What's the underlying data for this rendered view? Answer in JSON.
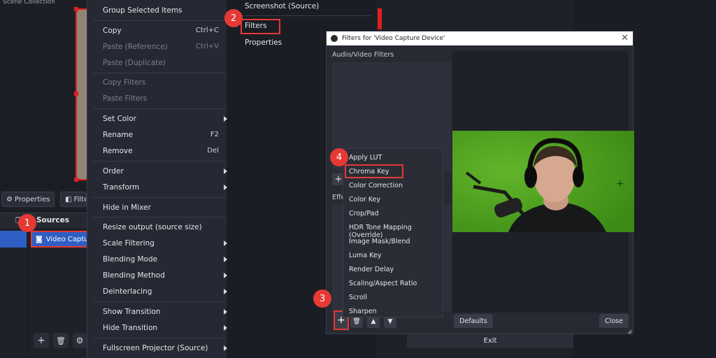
{
  "background": {
    "top_text": "Scene Collection",
    "properties_button": "Properties",
    "filters_button": "Filte",
    "sources_header": "Sources",
    "source_item": "Video Captu"
  },
  "context_menu": {
    "items": [
      {
        "label": "Group Selected Items"
      },
      {
        "label": "Copy",
        "shortcut": "Ctrl+C"
      },
      {
        "label": "Paste (Reference)",
        "shortcut": "Ctrl+V",
        "disabled": true
      },
      {
        "label": "Paste (Duplicate)",
        "disabled": true
      },
      {
        "label": "Copy Filters",
        "disabled": true
      },
      {
        "label": "Paste Filters",
        "disabled": true
      },
      {
        "label": "Set Color",
        "submenu": true
      },
      {
        "label": "Rename",
        "shortcut": "F2"
      },
      {
        "label": "Remove",
        "shortcut": "Del"
      },
      {
        "label": "Order",
        "submenu": true
      },
      {
        "label": "Transform",
        "submenu": true
      },
      {
        "label": "Hide in Mixer"
      },
      {
        "label": "Resize output (source size)"
      },
      {
        "label": "Scale Filtering",
        "submenu": true
      },
      {
        "label": "Blending Mode",
        "submenu": true
      },
      {
        "label": "Blending Method",
        "submenu": true
      },
      {
        "label": "Deinterlacing",
        "submenu": true
      },
      {
        "label": "Show Transition",
        "submenu": true
      },
      {
        "label": "Hide Transition",
        "submenu": true
      },
      {
        "label": "Fullscreen Projector (Source)",
        "submenu": true
      }
    ]
  },
  "submenu": {
    "screenshot": "Screenshot (Source)",
    "filters": "Filters",
    "properties": "Properties"
  },
  "dialog": {
    "title": "Filters for 'Video Capture Device'",
    "audio_video_label": "Audio/Video Filters",
    "effect_label": "Effe",
    "defaults_button": "Defaults",
    "close_button": "Close"
  },
  "dropdown": {
    "items": [
      "Apply LUT",
      "Chroma Key",
      "Color Correction",
      "Color Key",
      "Crop/Pad",
      "HDR Tone Mapping (Override)",
      "Image Mask/Blend",
      "Luma Key",
      "Render Delay",
      "Scaling/Aspect Ratio",
      "Scroll",
      "Sharpen"
    ]
  },
  "exit_button": "Exit",
  "steps": [
    "1",
    "2",
    "3",
    "4"
  ],
  "colors": {
    "highlight": "#e53935",
    "selection": "#2f5ec4",
    "green_screen": "#4a9a1c"
  }
}
